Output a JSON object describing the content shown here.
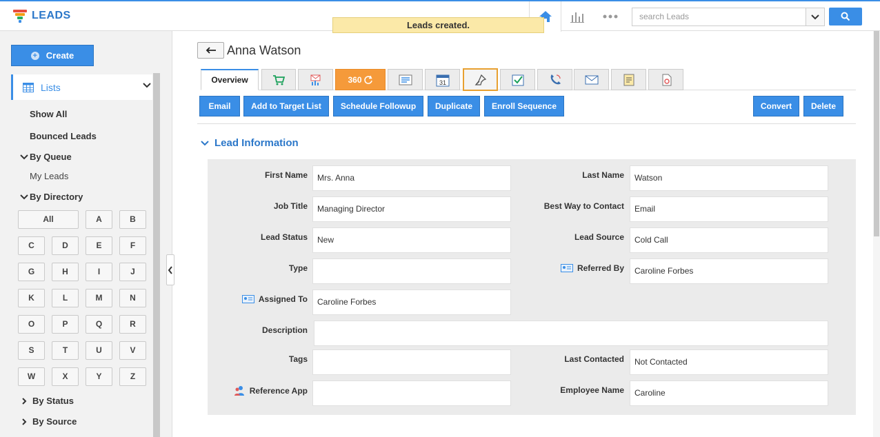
{
  "app": {
    "name": "LEADS"
  },
  "header": {
    "search_placeholder": "search Leads",
    "toast": "Leads created."
  },
  "sidebar": {
    "create_label": "Create",
    "lists_label": "Lists",
    "show_all": "Show All",
    "bounced": "Bounced Leads",
    "by_queue": "By Queue",
    "my_leads": "My Leads",
    "by_directory": "By Directory",
    "letters": [
      "All",
      "A",
      "B",
      "C",
      "D",
      "E",
      "F",
      "G",
      "H",
      "I",
      "J",
      "K",
      "L",
      "M",
      "N",
      "O",
      "P",
      "Q",
      "R",
      "S",
      "T",
      "U",
      "V",
      "W",
      "X",
      "Y",
      "Z"
    ],
    "by_status": "By Status",
    "by_source": "By Source"
  },
  "record": {
    "title": "Anna Watson"
  },
  "tabs": {
    "overview": "Overview",
    "three60": "360",
    "calendar_day": "31"
  },
  "actions": {
    "email": "Email",
    "add_target": "Add to Target List",
    "schedule": "Schedule Followup",
    "duplicate": "Duplicate",
    "enroll": "Enroll Sequence",
    "convert": "Convert",
    "delete": "Delete"
  },
  "section": {
    "title": "Lead Information"
  },
  "fields": {
    "first_name": {
      "label": "First Name",
      "value": "Mrs. Anna"
    },
    "last_name": {
      "label": "Last Name",
      "value": "Watson"
    },
    "job_title": {
      "label": "Job Title",
      "value": "Managing Director"
    },
    "best_way": {
      "label": "Best Way to Contact",
      "value": "Email"
    },
    "lead_status": {
      "label": "Lead Status",
      "value": "New"
    },
    "lead_source": {
      "label": "Lead Source",
      "value": "Cold Call"
    },
    "type": {
      "label": "Type",
      "value": ""
    },
    "referred_by": {
      "label": "Referred By",
      "value": "Caroline Forbes"
    },
    "assigned_to": {
      "label": "Assigned To",
      "value": "Caroline Forbes"
    },
    "description": {
      "label": "Description",
      "value": ""
    },
    "tags": {
      "label": "Tags",
      "value": ""
    },
    "last_contacted": {
      "label": "Last Contacted",
      "value": "Not Contacted"
    },
    "reference_app": {
      "label": "Reference App",
      "value": ""
    },
    "employee_name": {
      "label": "Employee Name",
      "value": "Caroline"
    }
  },
  "colors": {
    "accent": "#3a8ee6",
    "orange": "#f59a3a",
    "toast": "#fbe9a8"
  }
}
